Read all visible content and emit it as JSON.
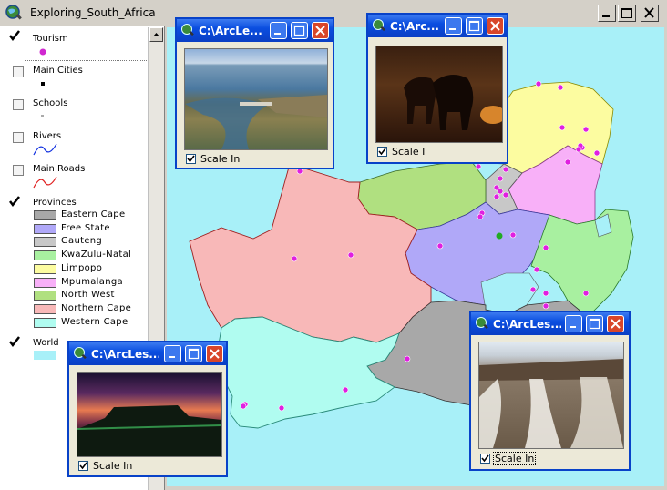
{
  "window": {
    "title": "Exploring_South_Africa"
  },
  "toc": {
    "layers": [
      {
        "name": "Tourism",
        "checked": true
      },
      {
        "name": "Main Cities",
        "checked": false
      },
      {
        "name": "Schools",
        "checked": false
      },
      {
        "name": "Rivers",
        "checked": false
      },
      {
        "name": "Main Roads",
        "checked": false
      },
      {
        "name": "Provinces",
        "checked": true
      },
      {
        "name": "World",
        "checked": true
      }
    ],
    "provinces_legend": [
      {
        "label": "Eastern Cape",
        "color": "#a8a8a8"
      },
      {
        "label": "Free State",
        "color": "#b0a8f8"
      },
      {
        "label": "Gauteng",
        "color": "#c8c8c8"
      },
      {
        "label": "KwaZulu-Natal",
        "color": "#a8f0a0"
      },
      {
        "label": "Limpopo",
        "color": "#fcfca0"
      },
      {
        "label": "Mpumalanga",
        "color": "#f8b0f8"
      },
      {
        "label": "North West",
        "color": "#b0e080"
      },
      {
        "label": "Northern Cape",
        "color": "#f8b8b8"
      },
      {
        "label": "Western Cape",
        "color": "#b0fcf0"
      }
    ],
    "world_color": "#a8f0f8"
  },
  "map": {
    "sea_color": "#a8f0f8",
    "tourism_marker_color": "#e020e0"
  },
  "popups": [
    {
      "title": "C:\\ArcLe...",
      "checkbox_label": "Scale In",
      "checked": true,
      "photo": "dam-aerial"
    },
    {
      "title": "C:\\Arc...",
      "checkbox_label": "Scale I",
      "checked": true,
      "photo": "elephants-sunset"
    },
    {
      "title": "C:\\ArcLes...",
      "checkbox_label": "Scale In",
      "checked": true,
      "photo": "table-mountain"
    },
    {
      "title": "C:\\ArcLes...",
      "checkbox_label": "Scale In",
      "checked": true,
      "photo": "waterfall"
    }
  ]
}
